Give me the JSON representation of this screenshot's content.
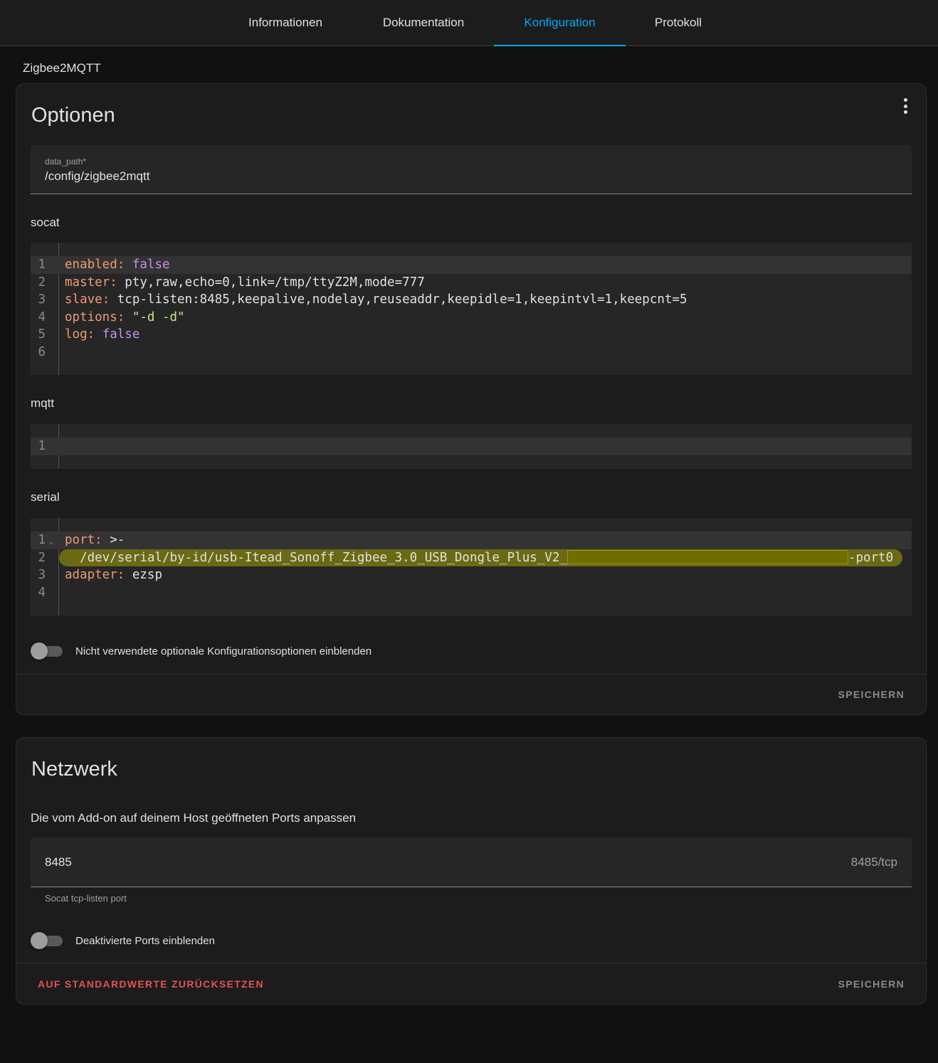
{
  "tabs": [
    {
      "label": "Informationen"
    },
    {
      "label": "Dokumentation"
    },
    {
      "label": "Konfiguration"
    },
    {
      "label": "Protokoll"
    }
  ],
  "addon_name": "Zigbee2MQTT",
  "options_card": {
    "title": "Optionen",
    "data_path": {
      "label": "data_path*",
      "value": "/config/zigbee2mqtt"
    },
    "socat": {
      "label": "socat",
      "lines": [
        {
          "n": "1",
          "key": "enabled",
          "value": "false"
        },
        {
          "n": "2",
          "key": "master",
          "value": "pty,raw,echo=0,link=/tmp/ttyZ2M,mode=777"
        },
        {
          "n": "3",
          "key": "slave",
          "value": "tcp-listen:8485,keepalive,nodelay,reuseaddr,keepidle=1,keepintvl=1,keepcnt=5"
        },
        {
          "n": "4",
          "key": "options",
          "value": "\"-d -d\""
        },
        {
          "n": "5",
          "key": "log",
          "value": "false"
        },
        {
          "n": "6"
        }
      ]
    },
    "mqtt": {
      "label": "mqtt",
      "lines": [
        {
          "n": "1"
        }
      ]
    },
    "serial": {
      "label": "serial",
      "lines": [
        {
          "n": "1",
          "key": "port",
          "value": ">-"
        },
        {
          "n": "2",
          "value_before": "  /dev/serial/by-id/usb-Itead_Sonoff_Zigbee_3.0_USB_Dongle_Plus_V2_",
          "value_after": "-port0"
        },
        {
          "n": "3",
          "key": "adapter",
          "value": "ezsp"
        },
        {
          "n": "4"
        }
      ]
    },
    "toggle_unused": "Nicht verwendete optionale Konfigurationsoptionen einblenden",
    "save": "Speichern"
  },
  "network_card": {
    "title": "Netzwerk",
    "description": "Die vom Add-on auf deinem Host geöffneten Ports anpassen",
    "port": {
      "value": "8485",
      "suffix": "8485/tcp",
      "helper": "Socat tcp-listen port"
    },
    "toggle_disabled_ports": "Deaktivierte Ports einblenden",
    "reset": "Auf Standardwerte zurücksetzen",
    "save": "Speichern"
  }
}
